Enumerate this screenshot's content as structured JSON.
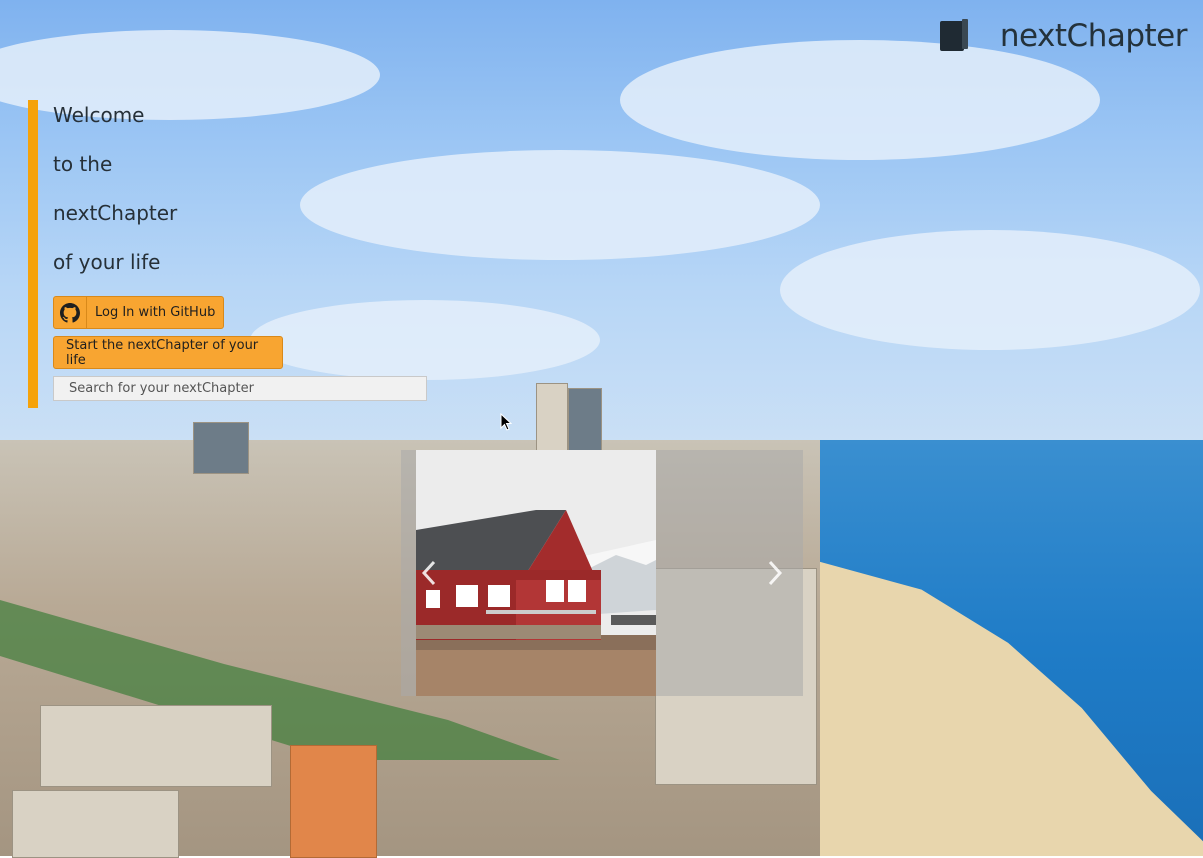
{
  "brand": {
    "name": "nextChapter",
    "icon": "book-icon"
  },
  "welcome": {
    "lines": [
      "Welcome",
      "to the",
      "nextChapter",
      "of your life"
    ]
  },
  "actions": {
    "github_label": "Log In with GitHub",
    "github_icon": "github-icon",
    "start_label": "Start the nextChapter of your life"
  },
  "search": {
    "placeholder": "Search for your nextChapter",
    "value": ""
  },
  "carousel": {
    "prev_icon": "chevron-left-icon",
    "next_icon": "chevron-right-icon"
  },
  "colors": {
    "accent": "#f8a531",
    "bar": "#f5a20a",
    "text": "#263038"
  }
}
